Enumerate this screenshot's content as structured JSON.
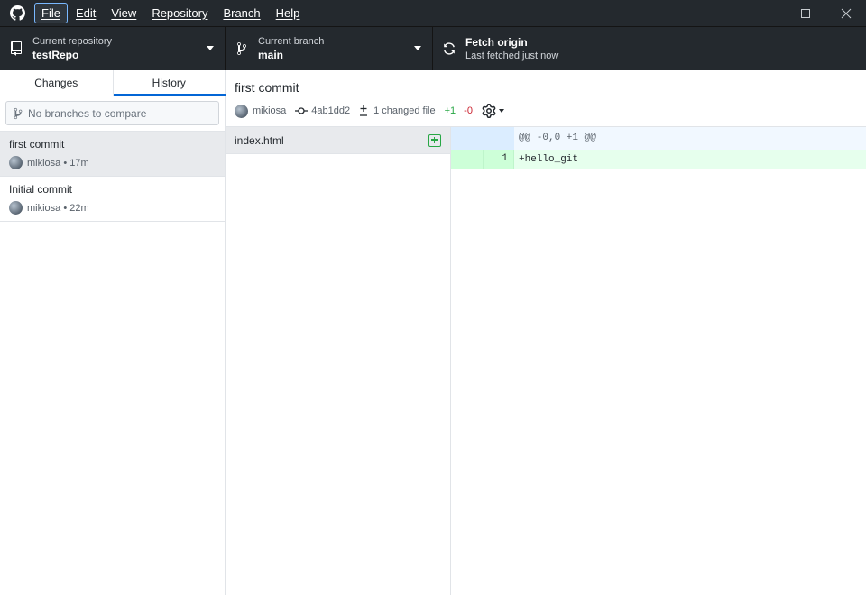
{
  "menu": [
    "File",
    "Edit",
    "View",
    "Repository",
    "Branch",
    "Help"
  ],
  "toolbar": {
    "repo_label": "Current repository",
    "repo_value": "testRepo",
    "branch_label": "Current branch",
    "branch_value": "main",
    "fetch_title": "Fetch origin",
    "fetch_sub": "Last fetched just now"
  },
  "sidebar": {
    "tabs": [
      "Changes",
      "History"
    ],
    "active_tab": "History",
    "compare_placeholder": "No branches to compare",
    "commits": [
      {
        "summary": "first commit",
        "author": "mikiosa",
        "time": "17m"
      },
      {
        "summary": "Initial commit",
        "author": "mikiosa",
        "time": "22m"
      }
    ]
  },
  "commit": {
    "title": "first commit",
    "author": "mikiosa",
    "sha": "4ab1dd2",
    "changed_files": "1 changed file",
    "additions": "+1",
    "deletions": "-0"
  },
  "files": [
    {
      "name": "index.html",
      "status": "added"
    }
  ],
  "diff": {
    "hunk_header": "@@ -0,0 +1 @@",
    "lines": [
      {
        "new_line": "1",
        "text": "+hello_git"
      }
    ]
  },
  "colors": {
    "accent": "#0366d6",
    "added": "#28a745",
    "removed": "#cb2431",
    "toolbar_bg": "#24292e"
  }
}
